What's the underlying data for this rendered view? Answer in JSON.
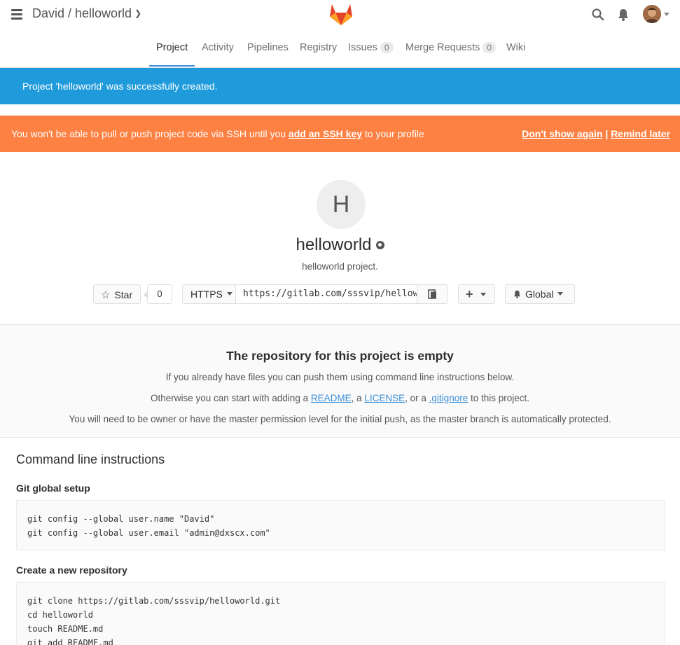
{
  "header": {
    "breadcrumb": "David / helloworld",
    "icons": [
      "menu-icon",
      "gitlab-logo",
      "search-icon",
      "bell-icon",
      "user-avatar"
    ]
  },
  "tabs": [
    {
      "label": "Project",
      "active": true
    },
    {
      "label": "Activity"
    },
    {
      "label": "Pipelines"
    },
    {
      "label": "Registry"
    },
    {
      "label": "Issues",
      "count": "0"
    },
    {
      "label": "Merge Requests",
      "count": "0"
    },
    {
      "label": "Wiki"
    }
  ],
  "flash_success": "Project 'helloworld' was successfully created.",
  "flash_ssh": {
    "text_before": "You won't be able to pull or push project code via SSH until you ",
    "link": "add an SSH key",
    "text_after": " to your profile",
    "dont_show": "Don't show again",
    "separator": " | ",
    "remind": "Remind later"
  },
  "project": {
    "avatar_letter": "H",
    "name": "helloworld",
    "description": "helloworld project.",
    "star_label": "Star",
    "star_count": "0",
    "protocol": "HTTPS",
    "clone_url": "https://gitlab.com/sssvip/helloworld.git",
    "plus_label": "+",
    "notification_label": "Global"
  },
  "empty_repo": {
    "title": "The repository for this project is empty",
    "line1": "If you already have files you can push them using command line instructions below.",
    "line2_before": "Otherwise you can start with adding a ",
    "readme": "README",
    "comma": ", a ",
    "license": "LICENSE",
    "or": ", or a ",
    "gitignore": ".gitignore",
    "line2_after": " to this project.",
    "line3": "You will need to be owner or have the master permission level for the initial push, as the master branch is automatically protected."
  },
  "cli": {
    "title": "Command line instructions",
    "global_setup_title": "Git global setup",
    "global_setup_code": "git config --global user.name \"David\"\ngit config --global user.email \"admin@dxscx.com\"",
    "new_repo_title": "Create a new repository",
    "new_repo_code": "git clone https://gitlab.com/sssvip/helloworld.git\ncd helloworld\ntouch README.md\ngit add README.md"
  },
  "colors": {
    "success_banner": "#1f9bdc",
    "warning_banner": "#fc8142",
    "link": "#3b8ed8",
    "logo_orange": "#e24329",
    "logo_light": "#fca326"
  }
}
